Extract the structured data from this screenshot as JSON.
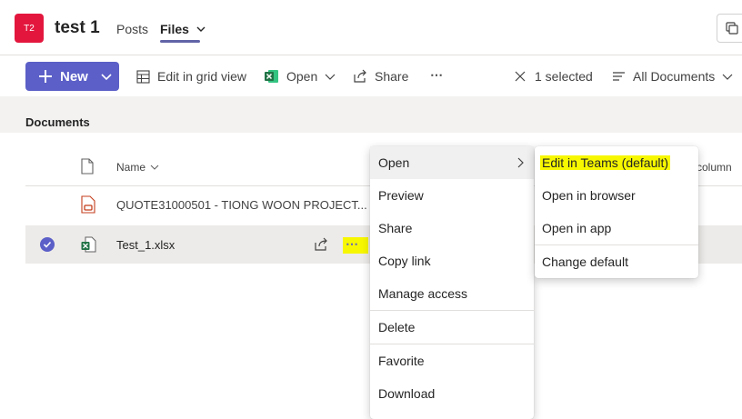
{
  "header": {
    "avatar_text": "T2",
    "team_name": "test 1",
    "tabs": [
      {
        "label": "Posts"
      },
      {
        "label": "Files"
      }
    ]
  },
  "toolbar": {
    "new_label": "New",
    "edit_grid_label": "Edit in grid view",
    "open_label": "Open",
    "share_label": "Share",
    "more_label": "⋯",
    "selected_label": "1 selected",
    "view_label": "All Documents"
  },
  "documents": {
    "title": "Documents",
    "column_name": "Name",
    "column_extra": "column",
    "files": [
      {
        "name": "QUOTE31000501 - TIONG WOON PROJECT..."
      },
      {
        "name": "Test_1.xlsx"
      }
    ],
    "row_more": "⋯"
  },
  "context_menu": {
    "items": [
      "Open",
      "Preview",
      "Share",
      "Copy link",
      "Manage access",
      "Delete",
      "Favorite",
      "Download"
    ]
  },
  "submenu": {
    "items": [
      "Edit in Teams (default)",
      "Open in browser",
      "Open in app",
      "Change default"
    ]
  },
  "colors": {
    "accent": "#5b5fc7",
    "avatar": "#e3173e",
    "highlight": "#f7f700",
    "excel_green": "#217346"
  }
}
